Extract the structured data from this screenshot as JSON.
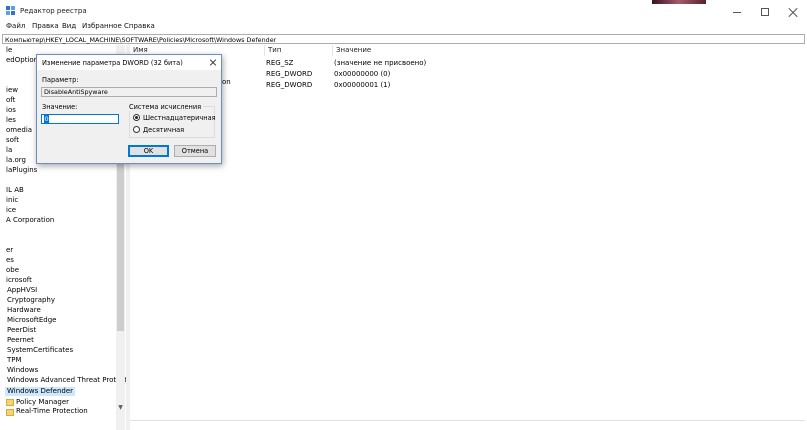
{
  "window": {
    "title": "Редактор реестра",
    "icon": "registry-editor-icon",
    "colors": {
      "selection": "#cce8ff",
      "accent": "#0078d7"
    }
  },
  "menu": [
    "Файл",
    "Правка",
    "Вид",
    "Избранное",
    "Справка"
  ],
  "address": "Компьютер\\HKEY_LOCAL_MACHINE\\SOFTWARE\\Policies\\Microsoft\\Windows Defender",
  "tree": [
    {
      "label": "le"
    },
    {
      "label": "edOptions"
    },
    {
      "label": "iew"
    },
    {
      "label": "oft"
    },
    {
      "label": "ios"
    },
    {
      "label": "les"
    },
    {
      "label": "omedia"
    },
    {
      "label": "soft"
    },
    {
      "label": "la"
    },
    {
      "label": "la.org"
    },
    {
      "label": "laPlugins"
    },
    {
      "label": "IL AB"
    },
    {
      "label": "inic"
    },
    {
      "label": "ice"
    },
    {
      "label": "A Corporation"
    },
    {
      "label": "er"
    },
    {
      "label": "es"
    },
    {
      "label": "obe"
    },
    {
      "label": "icrosoft"
    },
    {
      "label": "AppHVSI"
    },
    {
      "label": "Cryptography"
    },
    {
      "label": "Hardware"
    },
    {
      "label": "MicrosoftEdge"
    },
    {
      "label": "PeerDist"
    },
    {
      "label": "Peernet"
    },
    {
      "label": "SystemCertificates"
    },
    {
      "label": "TPM"
    },
    {
      "label": "Windows"
    },
    {
      "label": "Windows Advanced Threat Protectio"
    },
    {
      "label": "Windows Defender"
    },
    {
      "label": "Policy Manager"
    },
    {
      "label": "Real-Time Protection"
    }
  ],
  "list": {
    "columns": [
      "Имя",
      "Тип",
      "Значение"
    ],
    "rows": [
      {
        "name": "",
        "type": "REG_SZ",
        "value": "(значение не присвоено)"
      },
      {
        "name": "",
        "type": "REG_DWORD",
        "value": "0x00000000 (0)"
      },
      {
        "name": "on",
        "type": "REG_DWORD",
        "value": "0x00000001 (1)"
      }
    ]
  },
  "dialog": {
    "title": "Изменение параметра DWORD (32 бита)",
    "param_label": "Параметр:",
    "param_value": "DisableAntiSpyware",
    "value_label": "Значение:",
    "value": "0",
    "radix_label": "Система исчисления",
    "radix_hex": "Шестнадцатеричная",
    "radix_dec": "Десятичная",
    "radix_selected": "hex",
    "ok": "OK",
    "cancel": "Отмена"
  }
}
